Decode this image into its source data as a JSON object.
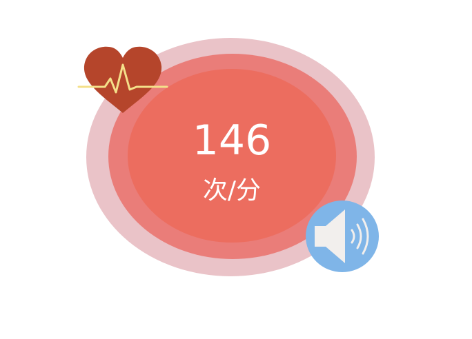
{
  "heart_rate": {
    "value": "146",
    "unit": "次/分"
  },
  "icons": {
    "heart": "heartbeat-icon",
    "speaker": "speaker-icon"
  },
  "colors": {
    "ring_outer": "#eac3c8",
    "ring_mid": "#ea7d79",
    "ring_inner": "#ec6d5f",
    "text": "#ffffff",
    "heart": "#b5452b",
    "pulse_line": "#f4e08a",
    "speaker_bg": "#7fb5e8",
    "speaker_fg": "#f2efed"
  }
}
